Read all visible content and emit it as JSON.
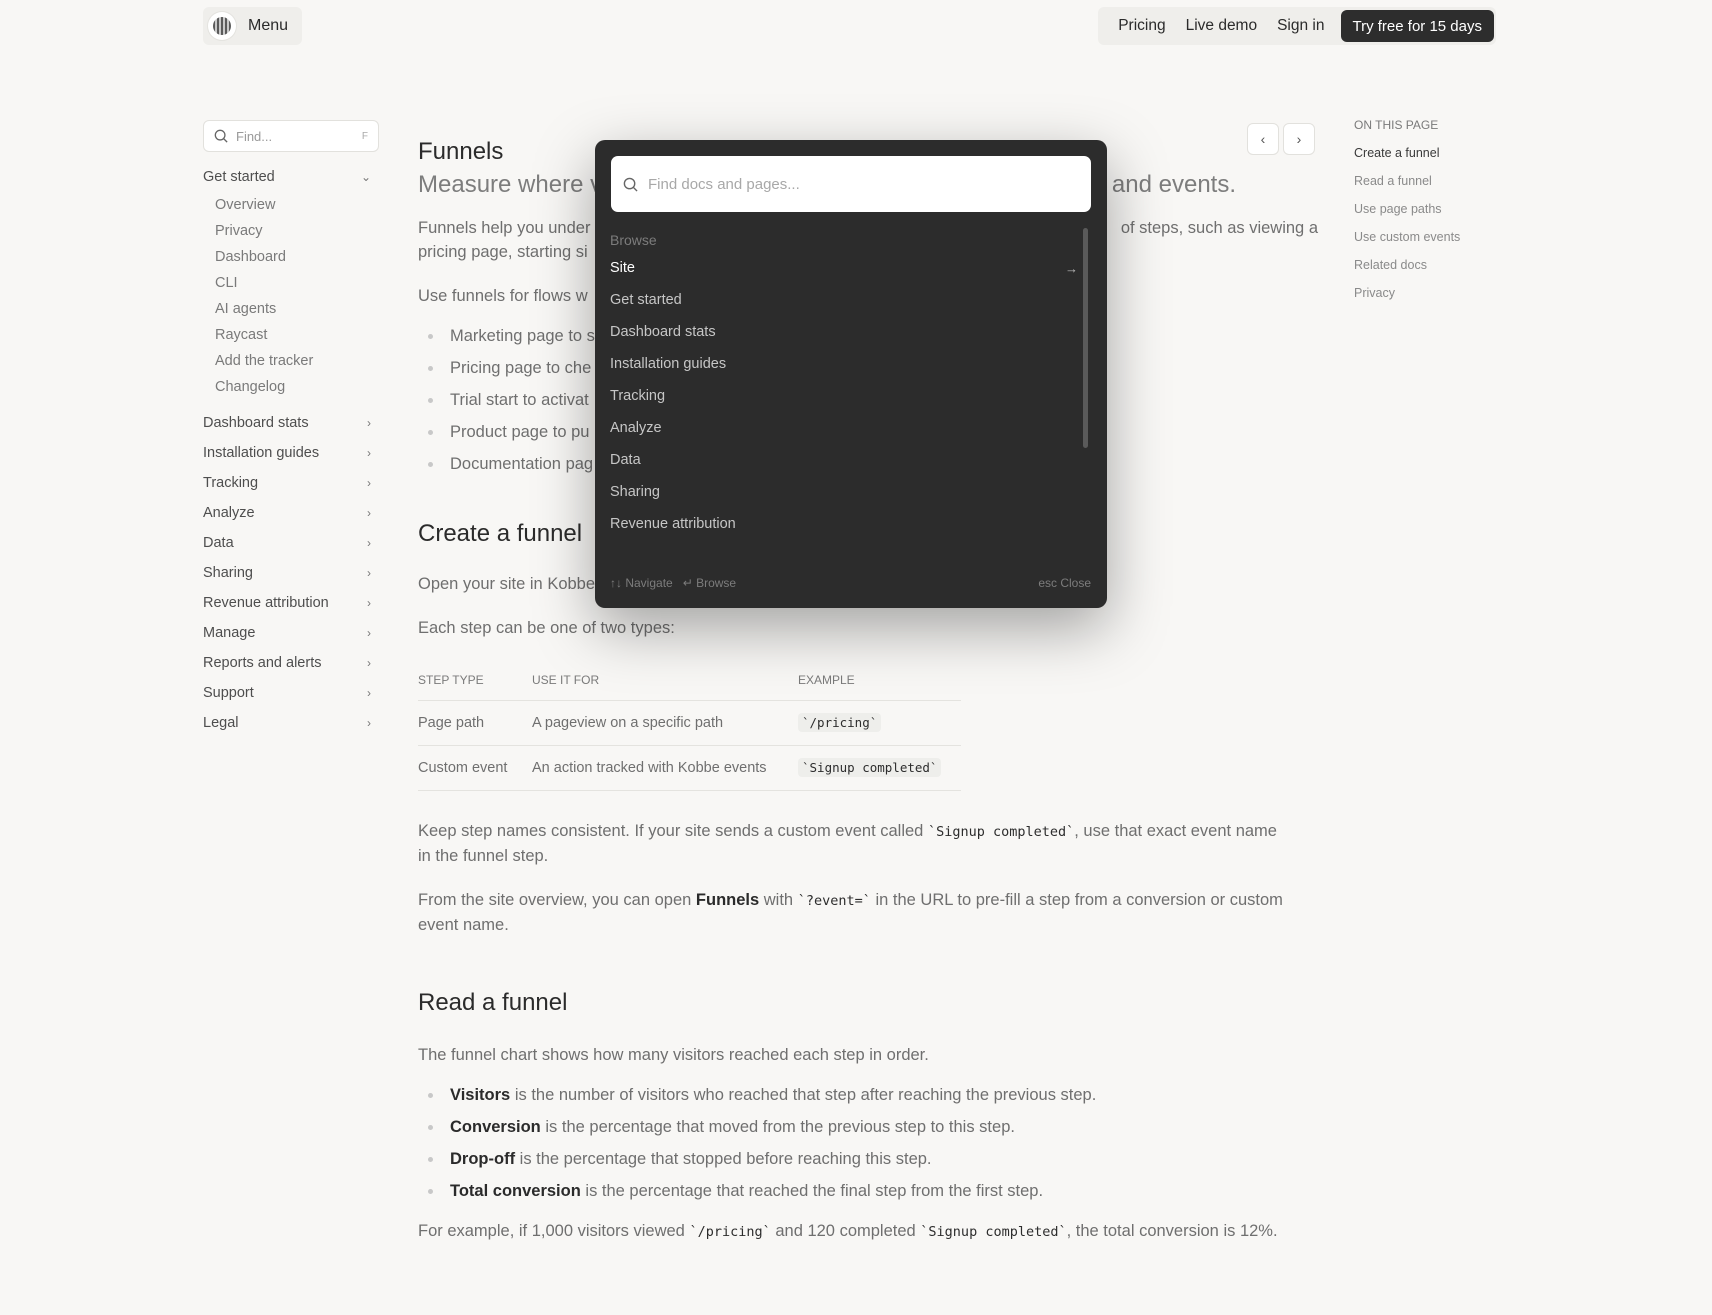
{
  "header": {
    "menu_label": "Menu",
    "nav": [
      "Pricing",
      "Live demo",
      "Sign in"
    ],
    "cta": "Try free for 15 days"
  },
  "sidebar": {
    "find_placeholder": "Find...",
    "find_shortcut": "F",
    "open_section": "Get started",
    "open_items": [
      "Overview",
      "Privacy",
      "Dashboard",
      "CLI",
      "AI agents",
      "Raycast",
      "Add the tracker",
      "Changelog"
    ],
    "sections": [
      "Dashboard stats",
      "Installation guides",
      "Tracking",
      "Analyze",
      "Data",
      "Sharing",
      "Revenue attribution",
      "Manage",
      "Reports and alerts",
      "Support",
      "Legal"
    ]
  },
  "main": {
    "title": "Funnels",
    "lead_left": "Measure where v",
    "lead_right": "and events.",
    "intro_left_1": "Funnels help you under",
    "intro_right_1": "of steps, such as viewing a",
    "intro_left_2": "pricing page, starting si",
    "use_left": "Use funnels for flows w",
    "use_bullets": [
      "Marketing page to s",
      "Pricing page to che",
      "Trial start to activat",
      "Product page to pu",
      "Documentation pag"
    ],
    "create_heading": "Create a funnel",
    "create_p_left": "Open your site in Kobbe",
    "types_p": "Each step can be one of two types:",
    "table": {
      "headers": [
        "STEP TYPE",
        "USE IT FOR",
        "EXAMPLE"
      ],
      "rows": [
        [
          "Page path",
          "A pageview on a specific path",
          "`/pricing`"
        ],
        [
          "Custom event",
          "An action tracked with Kobbe events",
          "`Signup completed`"
        ]
      ]
    },
    "keep_p_1": "Keep step names consistent. If your site sends a custom event called",
    "keep_code": "`Signup completed`",
    "keep_p_2": ", use that exact event name",
    "keep_p_3": "in the funnel step.",
    "from_p_1": "From the site overview, you can open",
    "from_bold": "Funnels",
    "from_p_2": "with",
    "from_code": "`?event=`",
    "from_p_3": "in the URL to pre-fill a step from a conversion or custom",
    "from_p_4": "event name.",
    "read_heading": "Read a funnel",
    "read_p": "The funnel chart shows how many visitors reached each step in order.",
    "read_bullets": [
      {
        "bold": "Visitors",
        "text": " is the number of visitors who reached that step after reaching the previous step."
      },
      {
        "bold": "Conversion",
        "text": " is the percentage that moved from the previous step to this step."
      },
      {
        "bold": "Drop-off",
        "text": " is the percentage that stopped before reaching this step."
      },
      {
        "bold": "Total conversion",
        "text": " is the percentage that reached the final step from the first step."
      }
    ],
    "example_1": "For example, if 1,000 visitors viewed",
    "example_code_1": "`/pricing`",
    "example_2": "and 120 completed",
    "example_code_2": "`Signup completed`",
    "example_3": ", the total conversion is 12%."
  },
  "toc": {
    "title": "ON THIS PAGE",
    "items": [
      "Create a funnel",
      "Read a funnel",
      "Use page paths",
      "Use custom events",
      "Related docs",
      "Privacy"
    ]
  },
  "palette": {
    "placeholder": "Find docs and pages...",
    "label": "Browse",
    "items": [
      "Site",
      "Get started",
      "Dashboard stats",
      "Installation guides",
      "Tracking",
      "Analyze",
      "Data",
      "Sharing",
      "Revenue attribution"
    ],
    "footer_navigate": "↑↓ Navigate",
    "footer_browse": "↵ Browse",
    "footer_close": "esc  Close"
  },
  "colors": {
    "accent_dark": "#2d2d2d",
    "page_bg": "#f8f7f5",
    "palette_bg": "#2c2c2c"
  }
}
